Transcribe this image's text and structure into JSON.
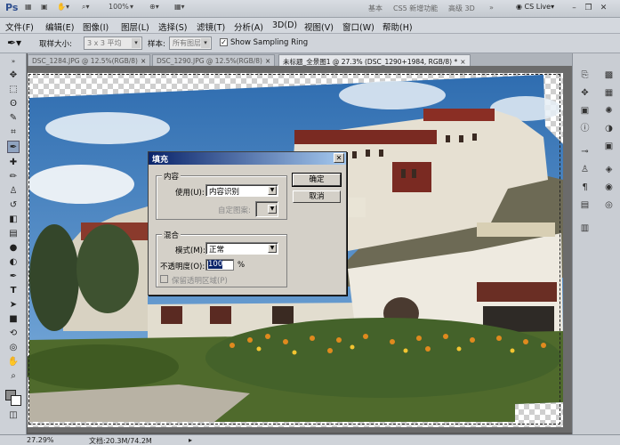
{
  "app": {
    "logo": "Ps",
    "zoom": "100%",
    "workspaces": [
      "基本",
      "CS5 新增功能",
      "高级 3D"
    ],
    "cs_live": "CS Live"
  },
  "menu": [
    "文件(F)",
    "编辑(E)",
    "图像(I)",
    "图层(L)",
    "选择(S)",
    "滤镜(T)",
    "分析(A)",
    "3D(D)",
    "视图(V)",
    "窗口(W)",
    "帮助(H)"
  ],
  "options": {
    "sample_size_label": "取样大小:",
    "sample_size_value": "3 x 3 平均",
    "sample_label": "样本:",
    "sample_value": "所有图层",
    "ring_label": "Show Sampling Ring",
    "ring_checked": true
  },
  "tabs": [
    {
      "label": "DSC_1284.JPG @ 12.5%(RGB/8)",
      "active": false
    },
    {
      "label": "DSC_1290.JPG @ 12.5%(RGB/8)",
      "active": false
    },
    {
      "label": "未标题_全景图1 @ 27.3% (DSC_1290+1984, RGB/8) *",
      "active": true
    }
  ],
  "dialog": {
    "title": "填充",
    "content_group": "内容",
    "use_label": "使用(U):",
    "use_value": "内容识别",
    "pattern_label": "自定图案:",
    "blend_group": "混合",
    "mode_label": "模式(M):",
    "mode_value": "正常",
    "opacity_label": "不透明度(O):",
    "opacity_value": "100",
    "opacity_unit": "%",
    "preserve_label": "保留透明区域(P)",
    "ok_label": "确定",
    "cancel_label": "取消"
  },
  "status": {
    "zoom": "27.29%",
    "doc": "文档:20.3M/74.2M"
  }
}
